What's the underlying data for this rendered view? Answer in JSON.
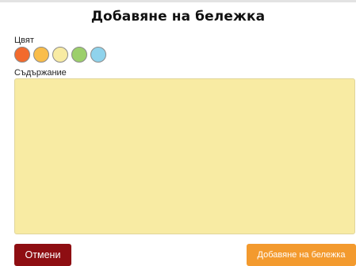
{
  "dialog": {
    "title": "Добавяне на бележка"
  },
  "color_picker": {
    "label": "Цвят",
    "swatches": [
      {
        "name": "orange",
        "color": "#f26a2d"
      },
      {
        "name": "amber",
        "color": "#f9bd4a"
      },
      {
        "name": "pale-yellow",
        "color": "#f8eba3"
      },
      {
        "name": "green",
        "color": "#9ccf6b"
      },
      {
        "name": "light-blue",
        "color": "#8fd3ec"
      }
    ]
  },
  "content": {
    "label": "Съдържание",
    "value": "",
    "background": "#f8eba3"
  },
  "buttons": {
    "cancel_label": "Отмени",
    "cancel_color": "#8e0e12",
    "add_label": "Добавяне на бележка",
    "add_color": "#f39a2e"
  }
}
